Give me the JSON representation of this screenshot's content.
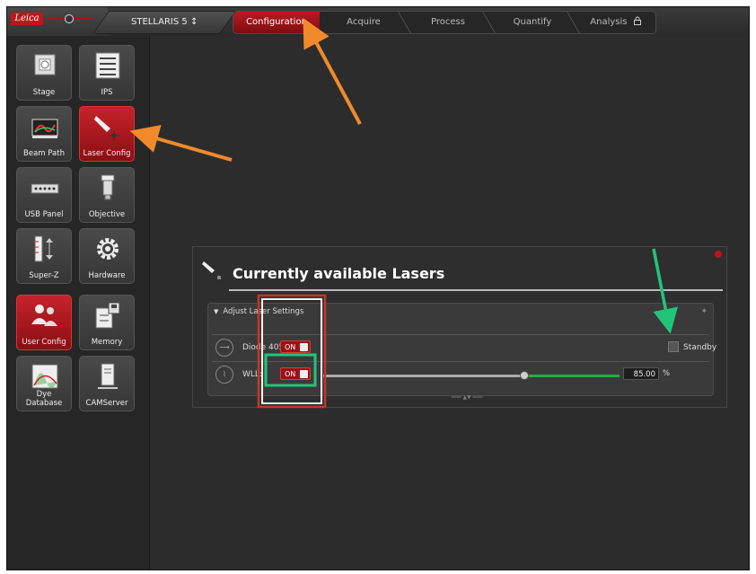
{
  "app": {
    "logo_text": "Leica"
  },
  "topbar": {
    "device_selector": "STELLARIS 5 ↕",
    "steps": [
      "Configuration",
      "Acquire",
      "Process",
      "Quantify",
      "Analysis"
    ]
  },
  "tools": [
    {
      "label": "Stage",
      "icon": "stage-icon",
      "active": false
    },
    {
      "label": "IPS",
      "icon": "ips-icon",
      "active": false
    },
    {
      "label": "Beam Path",
      "icon": "beam-path-icon",
      "active": false
    },
    {
      "label": "Laser Config",
      "icon": "laser-config-icon",
      "active": true
    },
    {
      "label": "USB Panel",
      "icon": "usb-panel-icon",
      "active": false
    },
    {
      "label": "Objective",
      "icon": "objective-icon",
      "active": false
    },
    {
      "label": "Super-Z",
      "icon": "super-z-icon",
      "active": false
    },
    {
      "label": "Hardware",
      "icon": "gear-icon",
      "active": false
    },
    {
      "label": "User Config",
      "icon": "user-config-icon",
      "active": true
    },
    {
      "label": "Memory",
      "icon": "memory-icon",
      "active": false
    },
    {
      "label": "Dye Database",
      "icon": "dye-database-icon",
      "active": false
    },
    {
      "label": "CAMServer",
      "icon": "camserver-icon",
      "active": false
    }
  ],
  "laser_panel": {
    "title": "Currently available Lasers",
    "section_header": "Adjust Laser Settings",
    "lasers": [
      {
        "name": "Diode 405:",
        "state": "ON",
        "standby_label": "Standby"
      },
      {
        "name": "WLL:",
        "state": "ON",
        "value": "85.00",
        "unit": "%",
        "level": 0.85
      }
    ]
  },
  "colors": {
    "accent_red": "#b71b21",
    "annotation_orange": "#f08a2b",
    "annotation_green": "#22c47a",
    "annotation_red": "#c0392b"
  }
}
